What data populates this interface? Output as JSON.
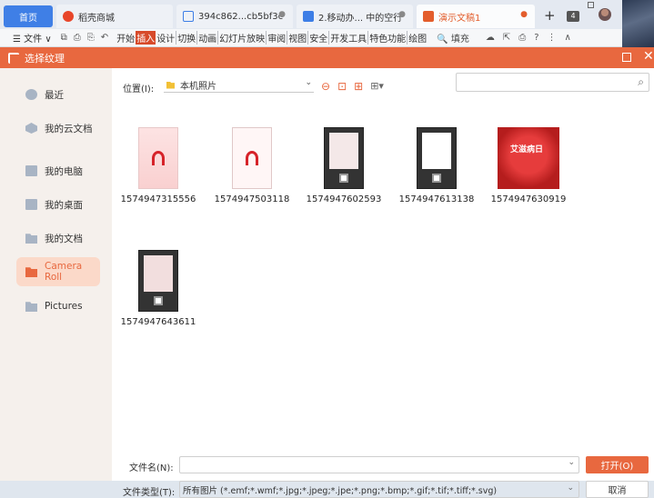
{
  "tabs": {
    "home": "首页",
    "items": [
      {
        "label": "稻壳商城",
        "icon": "docer-icon",
        "color": "#e8462a",
        "closable": false
      },
      {
        "label": "394c862...cb5bf3c",
        "icon": "doc-icon",
        "color": "#3d7ee6",
        "closable": true
      },
      {
        "label": "2.移动办... 中的空行",
        "icon": "word-icon",
        "color": "#3d7ee6",
        "closable": true
      },
      {
        "label": "演示文稿1",
        "icon": "ppt-icon",
        "color": "#e35d2c",
        "closable": true
      }
    ],
    "close_glyph": "●",
    "new_tab": "+",
    "tab_count": "4"
  },
  "ribbon": {
    "menu_label": "☰ 文件 ∨",
    "quick_icons": [
      "⧉",
      "⎙",
      "⎘",
      "↶"
    ],
    "menu_tabs": [
      "开始",
      "插入",
      "设计",
      "切换",
      "动画",
      "幻灯片放映",
      "审阅",
      "视图",
      "安全",
      "开发工具",
      "特色功能",
      "绘图"
    ],
    "active_tab_index": 1,
    "search_label": "🔍 填充",
    "right_icons": [
      "☁",
      "⇱",
      "⎙",
      "?",
      "⋮",
      "∧"
    ]
  },
  "dialog": {
    "title": "选择纹理",
    "accent_color": "#e8683f",
    "sidebar": [
      {
        "label": "最近",
        "icon": "clock-icon",
        "active": false
      },
      {
        "label": "我的云文档",
        "icon": "cloud-icon",
        "active": false
      },
      {
        "label": "我的电脑",
        "icon": "computer-icon",
        "active": false
      },
      {
        "label": "我的桌面",
        "icon": "desktop-icon",
        "active": false
      },
      {
        "label": "我的文档",
        "icon": "folder-icon",
        "active": false
      },
      {
        "label": "Camera Roll",
        "icon": "folder-icon",
        "active": true
      },
      {
        "label": "Pictures",
        "icon": "folder-icon",
        "active": false
      }
    ],
    "location_label": "位置(I):",
    "location_value": "本机照片",
    "search_placeholder": "",
    "files": [
      {
        "name": "1574947315556",
        "thumb": "pink-poster"
      },
      {
        "name": "1574947503118",
        "thumb": "light-poster"
      },
      {
        "name": "1574947602593",
        "thumb": "dark-poster"
      },
      {
        "name": "1574947613138",
        "thumb": "dark-poster"
      },
      {
        "name": "1574947630919",
        "thumb": "red-square",
        "text": "艾滋病日"
      },
      {
        "name": "1574947643611",
        "thumb": "dark-poster"
      }
    ],
    "filename_label": "文件名(N):",
    "filename_value": "",
    "filetype_label": "文件类型(T):",
    "filetype_value": "所有图片 (*.emf;*.wmf;*.jpg;*.jpeg;*.jpe;*.png;*.bmp;*.gif;*.tif;*.tiff;*.svg)",
    "open_button": "打开(O)",
    "cancel_button": "取消"
  }
}
